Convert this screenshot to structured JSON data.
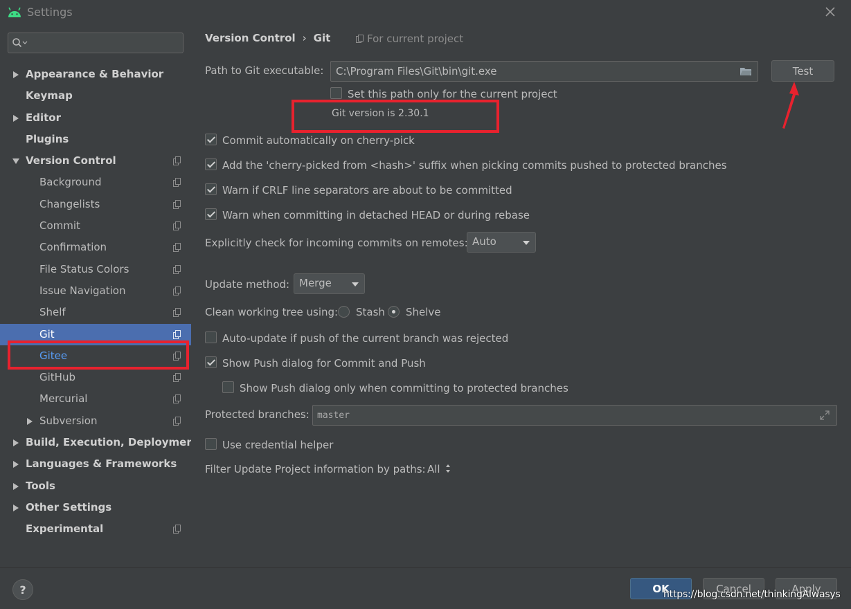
{
  "window": {
    "title": "Settings"
  },
  "sidebar": {
    "search_placeholder": "",
    "items": [
      {
        "label": "Appearance & Behavior",
        "level": 0,
        "bold": true,
        "arrow": "right",
        "proj": false
      },
      {
        "label": "Keymap",
        "level": 0,
        "bold": true,
        "arrow": "none",
        "proj": false
      },
      {
        "label": "Editor",
        "level": 0,
        "bold": true,
        "arrow": "right",
        "proj": false
      },
      {
        "label": "Plugins",
        "level": 0,
        "bold": true,
        "arrow": "none",
        "proj": false
      },
      {
        "label": "Version Control",
        "level": 0,
        "bold": true,
        "arrow": "down",
        "proj": true
      },
      {
        "label": "Background",
        "level": 1,
        "bold": false,
        "arrow": "none",
        "proj": true
      },
      {
        "label": "Changelists",
        "level": 1,
        "bold": false,
        "arrow": "none",
        "proj": true
      },
      {
        "label": "Commit",
        "level": 1,
        "bold": false,
        "arrow": "none",
        "proj": true
      },
      {
        "label": "Confirmation",
        "level": 1,
        "bold": false,
        "arrow": "none",
        "proj": true
      },
      {
        "label": "File Status Colors",
        "level": 1,
        "bold": false,
        "arrow": "none",
        "proj": true
      },
      {
        "label": "Issue Navigation",
        "level": 1,
        "bold": false,
        "arrow": "none",
        "proj": true
      },
      {
        "label": "Shelf",
        "level": 1,
        "bold": false,
        "arrow": "none",
        "proj": true
      },
      {
        "label": "Git",
        "level": 1,
        "bold": false,
        "arrow": "none",
        "proj": true,
        "selected": true
      },
      {
        "label": "Gitee",
        "level": 1,
        "bold": false,
        "arrow": "none",
        "proj": true,
        "link": true
      },
      {
        "label": "GitHub",
        "level": 1,
        "bold": false,
        "arrow": "none",
        "proj": true
      },
      {
        "label": "Mercurial",
        "level": 1,
        "bold": false,
        "arrow": "none",
        "proj": true
      },
      {
        "label": "Subversion",
        "level": 1,
        "bold": false,
        "arrow": "right",
        "proj": true
      },
      {
        "label": "Build, Execution, Deployment",
        "level": 0,
        "bold": true,
        "arrow": "right",
        "proj": false
      },
      {
        "label": "Languages & Frameworks",
        "level": 0,
        "bold": true,
        "arrow": "right",
        "proj": false
      },
      {
        "label": "Tools",
        "level": 0,
        "bold": true,
        "arrow": "right",
        "proj": false
      },
      {
        "label": "Other Settings",
        "level": 0,
        "bold": true,
        "arrow": "right",
        "proj": false
      },
      {
        "label": "Experimental",
        "level": 0,
        "bold": true,
        "arrow": "none",
        "proj": true
      }
    ]
  },
  "header": {
    "crumb_parent": "Version Control",
    "crumb_separator": "›",
    "crumb_current": "Git",
    "scope": "For current project"
  },
  "git": {
    "path_label": "Path to Git executable:",
    "path_value": "C:\\Program Files\\Git\\bin\\git.exe",
    "test_label": "Test",
    "set_path_label": "Set this path only for the current project",
    "set_path_checked": false,
    "version_text": "Git version is 2.30.1",
    "options": [
      {
        "label": "Commit automatically on cherry-pick",
        "checked": true
      },
      {
        "label": "Add the 'cherry-picked from <hash>' suffix when picking commits pushed to protected branches",
        "checked": true
      },
      {
        "label": "Warn if CRLF line separators are about to be committed",
        "checked": true
      },
      {
        "label": "Warn when committing in detached HEAD or during rebase",
        "checked": true
      }
    ],
    "incoming_label": "Explicitly check for incoming commits on remotes:",
    "incoming_value": "Auto",
    "update_method_label": "Update method:",
    "update_method_value": "Merge",
    "clean_tree_label": "Clean working tree using:",
    "stash_label": "Stash",
    "shelve_label": "Shelve",
    "clean_tree_selected": "Shelve",
    "auto_update_label": "Auto-update if push of the current branch was rejected",
    "auto_update_checked": false,
    "show_push_label": "Show Push dialog for Commit and Push",
    "show_push_checked": true,
    "show_push_protected_label": "Show Push dialog only when committing to protected branches",
    "show_push_protected_checked": false,
    "protected_label": "Protected branches:",
    "protected_value": "master",
    "credential_label": "Use credential helper",
    "credential_checked": false,
    "filter_label": "Filter Update Project information by paths:",
    "filter_value": "All"
  },
  "footer": {
    "help_label": "?",
    "ok_label": "OK",
    "cancel_label": "Cancel",
    "apply_label": "Apply",
    "watermark": "https://blog.csdn.net/thinkingAlwasys"
  },
  "colors": {
    "background": "#3c3f41",
    "selection": "#4b6eaf",
    "link": "#589df6",
    "annotation": "#e8222e",
    "android_green": "#3ddc84"
  }
}
